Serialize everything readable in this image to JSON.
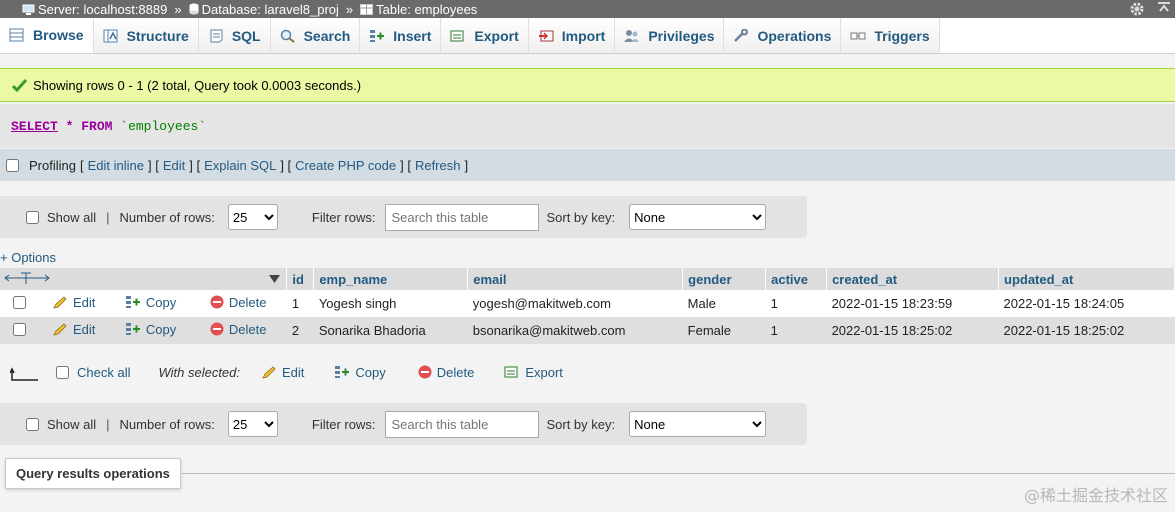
{
  "breadcrumb": {
    "server": "Server: localhost:8889",
    "database": "Database: laravel8_proj",
    "table": "Table: employees",
    "separator": "»"
  },
  "tabs": [
    {
      "label": "Browse",
      "icon": "browse-icon",
      "active": true
    },
    {
      "label": "Structure",
      "icon": "structure-icon"
    },
    {
      "label": "SQL",
      "icon": "sql-icon"
    },
    {
      "label": "Search",
      "icon": "search-icon"
    },
    {
      "label": "Insert",
      "icon": "insert-icon"
    },
    {
      "label": "Export",
      "icon": "export-icon"
    },
    {
      "label": "Import",
      "icon": "import-icon"
    },
    {
      "label": "Privileges",
      "icon": "privileges-icon"
    },
    {
      "label": "Operations",
      "icon": "operations-icon"
    },
    {
      "label": "Triggers",
      "icon": "triggers-icon"
    }
  ],
  "message": {
    "text": "Showing rows 0 - 1 (2 total, Query took 0.0003 seconds.)"
  },
  "query": {
    "select": "SELECT",
    "star": "*",
    "from": "FROM",
    "table": "`employees`"
  },
  "profiling": {
    "label": "Profiling",
    "open": "[",
    "close": "]",
    "sep": "] [",
    "links": [
      "Edit inline",
      "Edit",
      "Explain SQL",
      "Create PHP code",
      "Refresh"
    ]
  },
  "nav": {
    "show_all": "Show all",
    "pipe": "|",
    "rows_label": "Number of rows:",
    "rows_value": "25",
    "filter_label": "Filter rows:",
    "filter_placeholder": "Search this table",
    "sort_label": "Sort by key:",
    "sort_value": "None"
  },
  "options_link": "+ Options",
  "columns": [
    "id",
    "emp_name",
    "email",
    "gender",
    "active",
    "created_at",
    "updated_at"
  ],
  "row_actions": {
    "edit": "Edit",
    "copy": "Copy",
    "delete": "Delete"
  },
  "rows": [
    {
      "id": "1",
      "emp_name": "Yogesh singh",
      "email": "yogesh@makitweb.com",
      "gender": "Male",
      "active": "1",
      "created_at": "2022-01-15 18:23:59",
      "updated_at": "2022-01-15 18:24:05"
    },
    {
      "id": "2",
      "emp_name": "Sonarika Bhadoria",
      "email": "bsonarika@makitweb.com",
      "gender": "Female",
      "active": "1",
      "created_at": "2022-01-15 18:25:02",
      "updated_at": "2022-01-15 18:25:02"
    }
  ],
  "with_selected": {
    "check_all": "Check all",
    "label": "With selected:",
    "edit": "Edit",
    "copy": "Copy",
    "delete": "Delete",
    "export": "Export"
  },
  "query_results_operations": "Query results operations",
  "watermark": "@稀土掘金技术社区",
  "colors": {
    "link": "#235a81",
    "success_bg": "#ebf8a4",
    "header_bg": "#dcdcdc",
    "even_row": "#dfdfdf"
  }
}
